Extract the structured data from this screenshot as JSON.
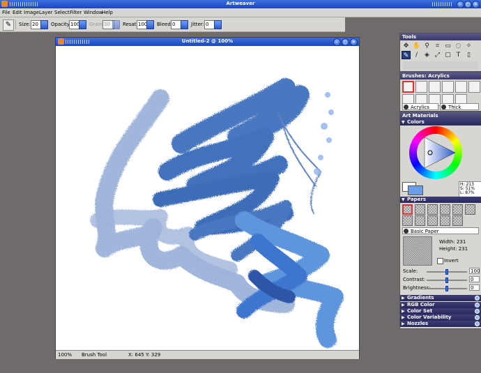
{
  "app": {
    "title": "Artweaver"
  },
  "menu": [
    "File",
    "Edit",
    "Image",
    "Layer",
    "Select",
    "Filter",
    "Window",
    "Help"
  ],
  "options": {
    "size_label": "Size:",
    "size_value": "20",
    "opacity_label": "Opacity:",
    "opacity_value": "100",
    "grain_label": "Grain:",
    "grain_value": "30",
    "resat_label": "Resat:",
    "resat_value": "100",
    "bleed_label": "Bleed:",
    "bleed_value": "0",
    "jitter_label": "Jitter:",
    "jitter_value": "0"
  },
  "document": {
    "title": "Untitled-2 @ 100%",
    "status": {
      "zoom": "100%",
      "tool": "Brush Tool",
      "coords": "X: 645  Y: 329"
    }
  },
  "tools_panel": {
    "title": "Tools"
  },
  "brushes_panel": {
    "title": "Brushes: Acrylics",
    "category": "Acrylics",
    "variant": "Thick Opaque..."
  },
  "art_materials": {
    "title": "Art Materials",
    "colors": {
      "label": "Colors",
      "h": "H: 213",
      "s": "S: 51%",
      "l": "L: 87%",
      "primary": "#6b9ee8",
      "secondary": "#ffffff"
    },
    "papers": {
      "label": "Papers",
      "selected": "Basic Paper",
      "width": "Width: 231",
      "height": "Height: 231",
      "invert": "Invert"
    },
    "sliders": [
      {
        "label": "Scale:",
        "value": "100",
        "level": 0.5
      },
      {
        "label": "Contrast:",
        "value": "0",
        "level": 0.5
      },
      {
        "label": "Brightness:",
        "value": "0",
        "level": 0.5
      }
    ],
    "sections": [
      "Gradients",
      "RGB Color",
      "Color Set",
      "Color Variability",
      "Nozzles"
    ]
  }
}
